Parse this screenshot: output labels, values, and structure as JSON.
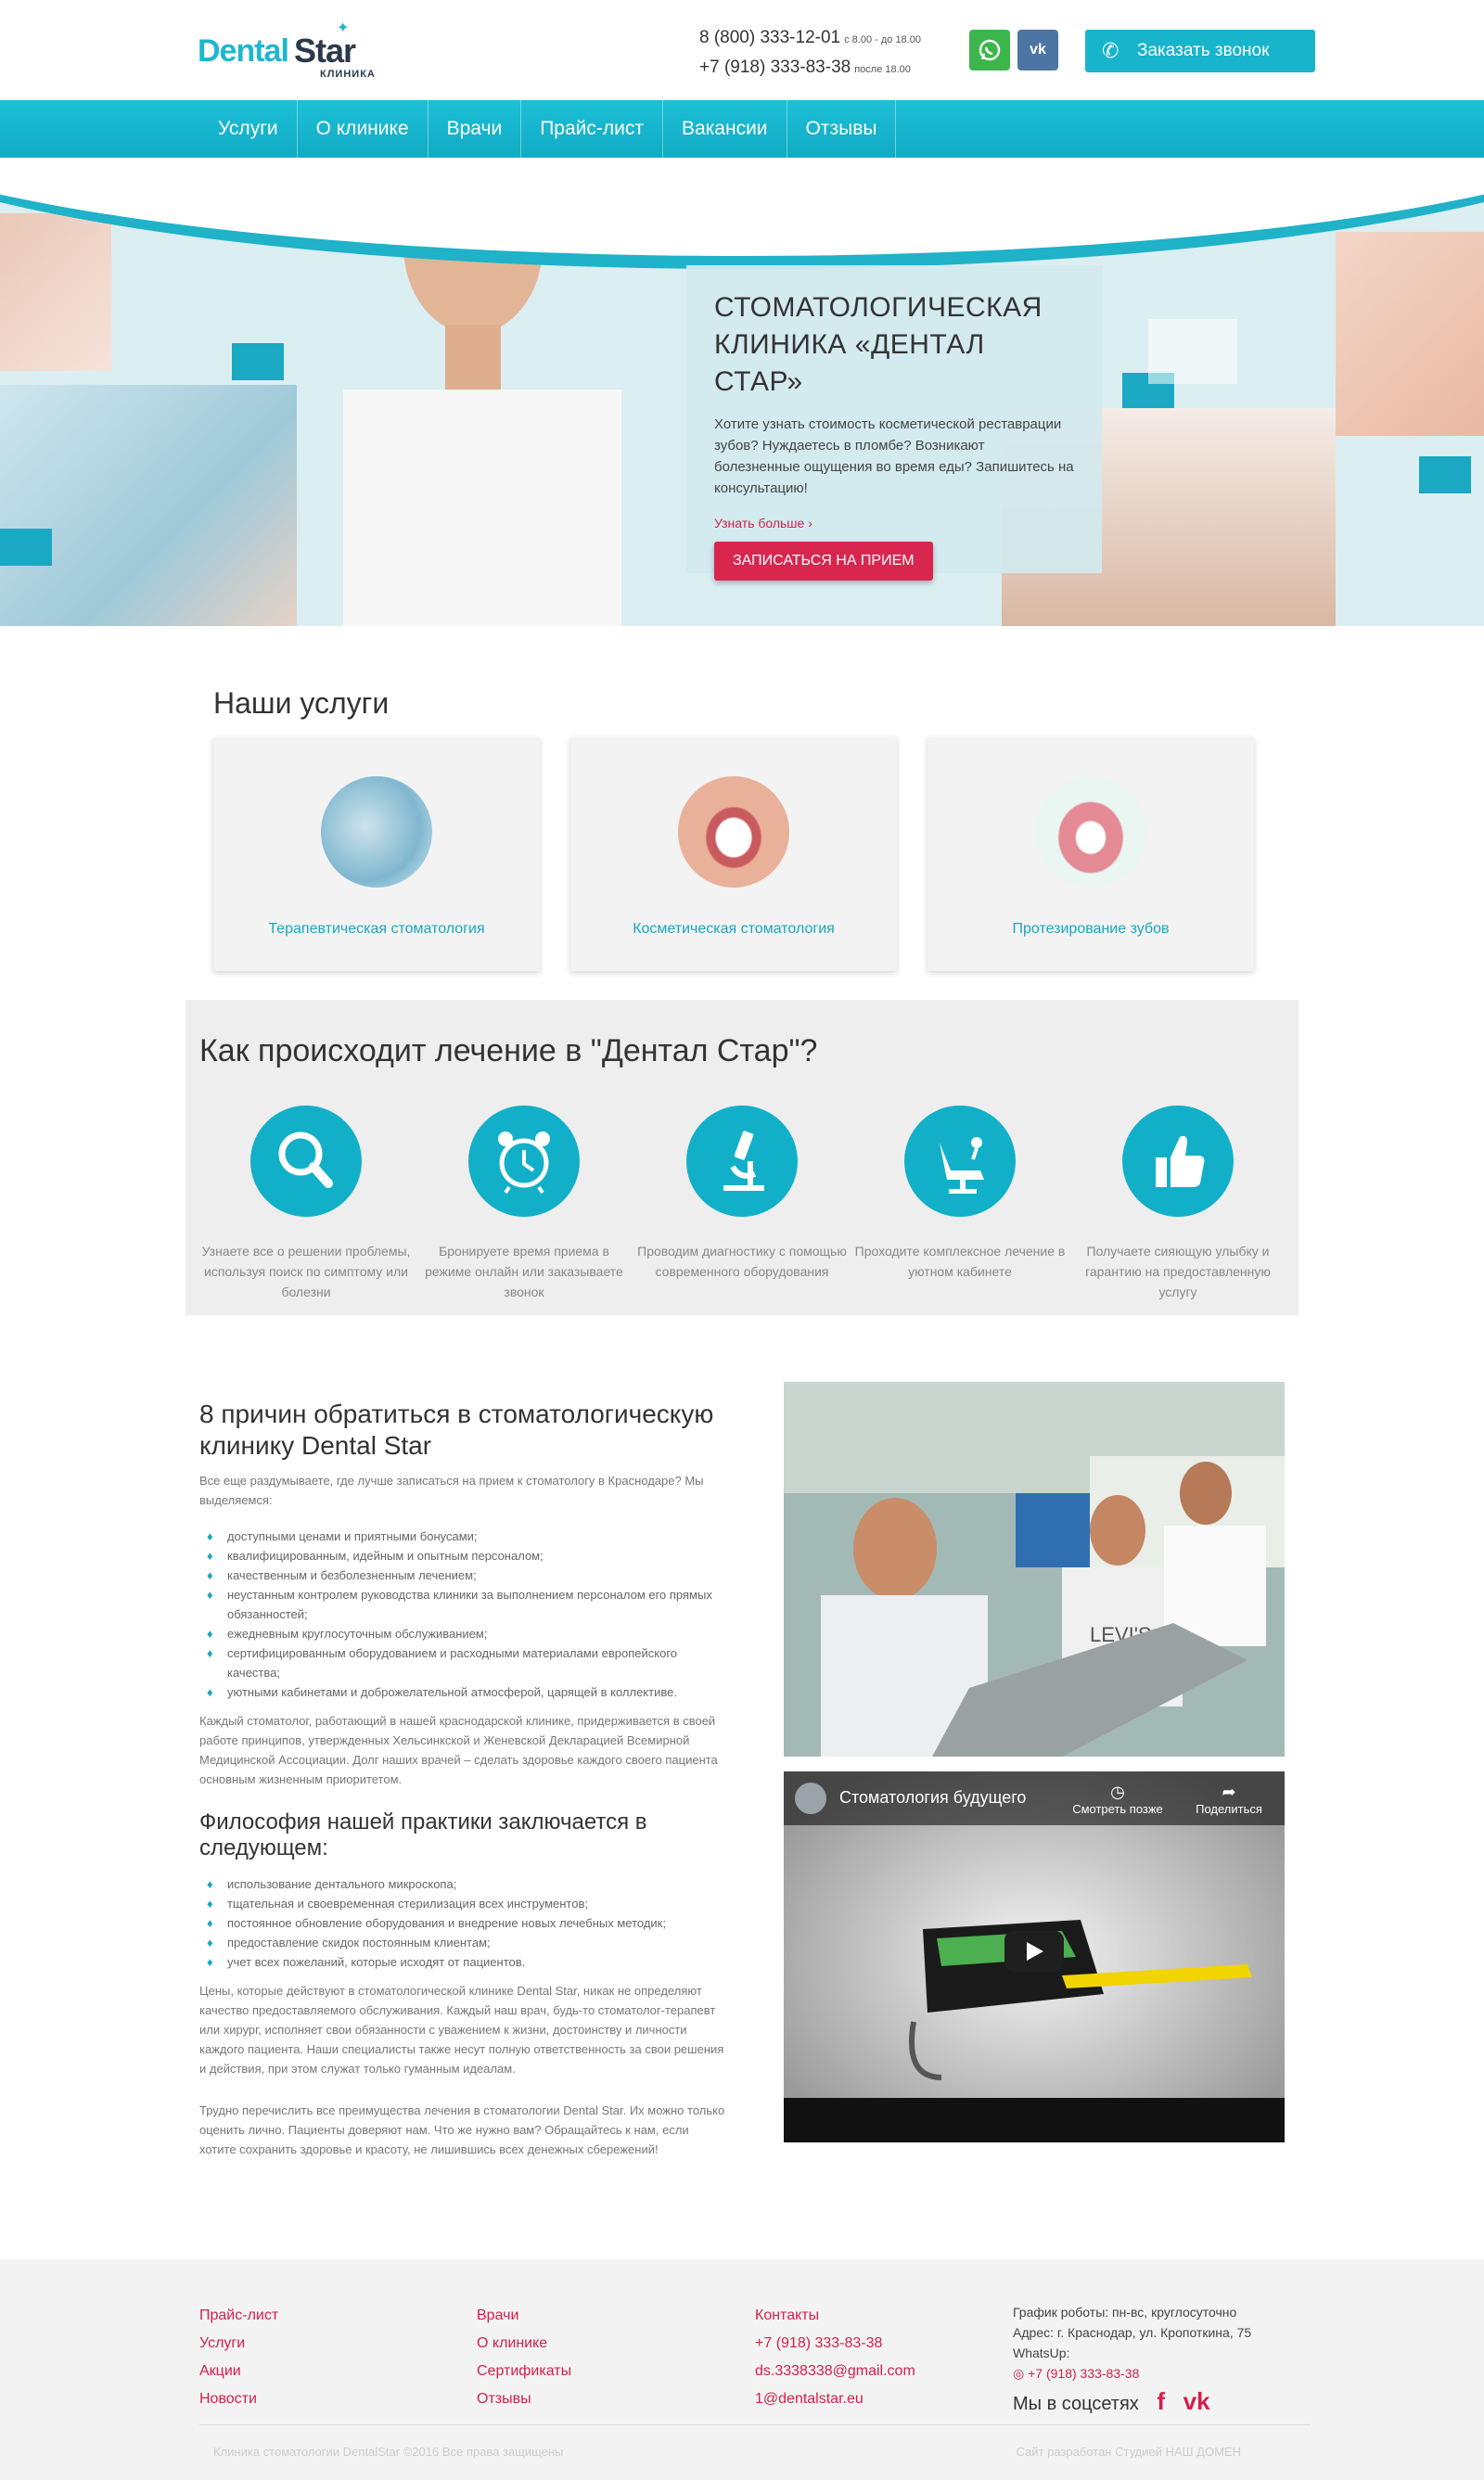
{
  "header": {
    "logo_word1": "Dental",
    "logo_word2": "Star",
    "logo_sub": "КЛИНИКА",
    "phone1": "8 (800) 333-12-01",
    "phone1_note": "с 8.00 - до 18.00",
    "phone2": "+7 (918) 333-83-38",
    "phone2_note": "после 18.00",
    "call_button": "Заказать звонок"
  },
  "nav": [
    "Услуги",
    "О клинике",
    "Врачи",
    "Прайс-лист",
    "Вакансии",
    "Отзывы"
  ],
  "hero": {
    "title": "СТОМАТОЛОГИЧЕСКАЯ КЛИНИКА «ДЕНТАЛ СТАР»",
    "text": "Хотите узнать стоимость косметической реставрации зубов? Нуждаетесь в пломбе? Возникают болезненные ощущения во время еды? Запишитесь на консультацию!",
    "more": "Узнать больше",
    "book": "ЗАПИСАТЬСЯ НА ПРИЕМ"
  },
  "services": {
    "title": "Наши услуги",
    "items": [
      {
        "label": "Терапевтическая стоматология"
      },
      {
        "label": "Косметическая стоматология"
      },
      {
        "label": "Протезирование зубов"
      }
    ]
  },
  "process": {
    "title": "Как происходит лечение в \"Дентал Стар\"?",
    "steps": [
      {
        "icon": "search-icon",
        "text": "Узнаете все о решении проблемы, используя поиск по симптому или болезни"
      },
      {
        "icon": "alarm-clock-icon",
        "text": "Бронируете время приема в режиме онлайн или заказываете звонок"
      },
      {
        "icon": "microscope-icon",
        "text": "Проводим диагностику с помощью современного оборудования"
      },
      {
        "icon": "dental-chair-icon",
        "text": "Проходите комплексное лечение в уютном кабинете"
      },
      {
        "icon": "thumbs-up-icon",
        "text": "Получаете сияющую улыбку и гарантию на предоставленную услугу"
      }
    ]
  },
  "reasons": {
    "title": "8 причин обратиться в стоматологическую клинику Dental Star",
    "intro": "Все еще раздумываете, где лучше записаться на прием к стоматологу в Краснодаре? Мы выделяемся:",
    "list1": [
      "доступными ценами и приятными бонусами;",
      "квалифицированным, идейным и опытным персоналом;",
      "качественным и безболезненным лечением;",
      "неустанным контролем руководства клиники за выполнением персоналом его прямых обязанностей;",
      "ежедневным круглосуточным обслуживанием;",
      "сертифицированным оборудованием и расходными материалами европейского качества;",
      "уютными кабинетами и доброжелательной атмосферой, царящей в коллективе."
    ],
    "para1": "Каждый стоматолог, работающий в нашей краснодарской клинике, придерживается в своей работе принципов, утвержденных Хельсинкской и Женевской Декларацией Всемирной Медицинской Ассоциации. Долг наших врачей – сделать здоровье каждого своего пациента основным жизненным приоритетом.",
    "subtitle": "Философия нашей практики заключается в следующем:",
    "list2": [
      "использование дентального микроскопа;",
      "тщательная и своевременная стерилизация всех инструментов;",
      "постоянное обновление оборудования и внедрение новых лечебных методик;",
      "предоставление скидок постоянным клиентам;",
      "учет всех пожеланий, которые исходят от пациентов."
    ],
    "para2": "Цены, которые действуют в стоматологической клинике Dental Star, никак не определяют качество предоставляемого обслуживания. Каждый наш врач, будь-то стоматолог-терапевт или хирург, исполняет свои обязанности с уважением к жизни, достоинству и личности каждого пациента. Наши специалисты также несут полную ответственность за свои решения и действия, при этом служат только гуманным идеалам.",
    "para3": "Трудно перечислить все преимущества лечения в стоматологии Dental Star. Их можно только оценить лично. Пациенты доверяют нам. Что же нужно вам? Обращайтесь к нам, если хотите сохранить здоровье и красоту, не лишившись всех денежных сбережений!"
  },
  "photo": {
    "shirt_text": "LEVI'S"
  },
  "video": {
    "title": "Стоматология будущего",
    "watch_later": "Смотреть позже",
    "share": "Поделиться"
  },
  "footer": {
    "col1": [
      "Прайс-лист",
      "Услуги",
      "Акции",
      "Новости"
    ],
    "col2": [
      "Врачи",
      "О клинике",
      "Сертификаты",
      "Отзывы"
    ],
    "col3": [
      "Контакты",
      "+7 (918) 333-83-38",
      "ds.3338338@gmail.com",
      "1@dentalstar.eu"
    ],
    "schedule": "График роботы: пн-вс, круглосуточно",
    "address": "Адрес: г. Краснодар, ул. Кропоткина, 75",
    "whatsapp_label": "WhatsUp:",
    "whatsapp_phone": "+7 (918) 333-83-38",
    "social_label": "Мы в соцсетях",
    "copyright": "Клиника стоматологии DentalStar ©2016 Все права защищены",
    "made_by": "Сайт разработан Студией НАШ ДОМЕН"
  },
  "colors": {
    "accent": "#17b4cc",
    "red": "#d8264f",
    "text": "#333333"
  }
}
